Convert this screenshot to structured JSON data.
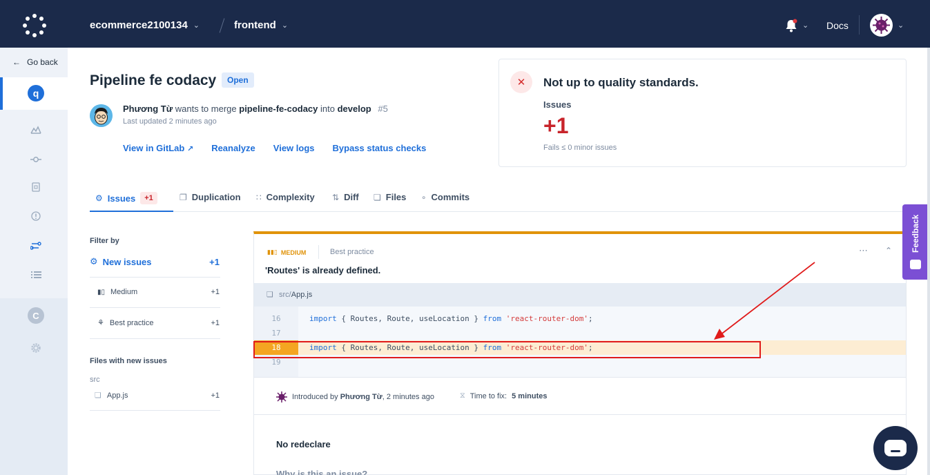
{
  "topbar": {
    "organization": "ecommerce2100134",
    "repository": "frontend",
    "docs_label": "Docs"
  },
  "sidebar": {
    "go_back": "Go back",
    "product_letter": "q",
    "secondary_letter": "C"
  },
  "pull_request": {
    "title": "Pipeline fe codacy",
    "status": "Open",
    "author": "Phương Từ",
    "wants_to_merge": "wants to merge",
    "source_branch": "pipeline-fe-codacy",
    "into": "into",
    "target_branch": "develop",
    "number": "#5",
    "last_updated": "Last updated 2 minutes ago",
    "actions": {
      "view_gitlab": "View in GitLab",
      "reanalyze": "Reanalyze",
      "view_logs": "View logs",
      "bypass": "Bypass status checks"
    }
  },
  "quality": {
    "title": "Not up to quality standards.",
    "issues_label": "Issues",
    "issues_delta": "+1",
    "fails_text": "Fails ≤ 0 minor issues"
  },
  "tabs": [
    {
      "label": "Issues",
      "badge": "+1"
    },
    {
      "label": "Duplication"
    },
    {
      "label": "Complexity"
    },
    {
      "label": "Diff"
    },
    {
      "label": "Files"
    },
    {
      "label": "Commits"
    }
  ],
  "filters": {
    "title": "Filter by",
    "new_issues_label": "New issues",
    "new_issues_count": "+1",
    "items": [
      {
        "label": "Medium",
        "count": "+1"
      },
      {
        "label": "Best practice",
        "count": "+1"
      }
    ],
    "files_title": "Files with new issues",
    "folder": "src",
    "files": [
      {
        "label": "App.js",
        "count": "+1"
      }
    ]
  },
  "issue": {
    "severity": "MEDIUM",
    "category": "Best practice",
    "message": "'Routes' is already defined.",
    "file_dir": "src/",
    "file_name": "App.js",
    "lines": [
      {
        "num": "16",
        "kw1": "import",
        "mid": " { Routes, Route, useLocation } ",
        "kw2": "from",
        "str": " 'react-router-dom'",
        "end": ";"
      },
      {
        "num": "17"
      },
      {
        "num": "18",
        "kw1": "import",
        "mid": " { Routes, Route, useLocation } ",
        "kw2": "from",
        "str": " 'react-router-dom'",
        "end": ";"
      },
      {
        "num": "19"
      }
    ],
    "introduced_prefix": "Introduced by",
    "introduced_author": "Phương Từ",
    "introduced_when": ", 2 minutes ago",
    "time_to_fix_label": "Time to fix:",
    "time_to_fix_value": "5 minutes",
    "pattern_title": "No redeclare",
    "why_title": "Why is this an issue?"
  },
  "feedback_label": "Feedback",
  "colors": {
    "topbar": "#1b2a4a",
    "accent": "#1f6fd9",
    "error": "#c8242b",
    "medium": "#e0930a",
    "annotation": "#e01b1b",
    "feedback": "#7b4fd4"
  }
}
